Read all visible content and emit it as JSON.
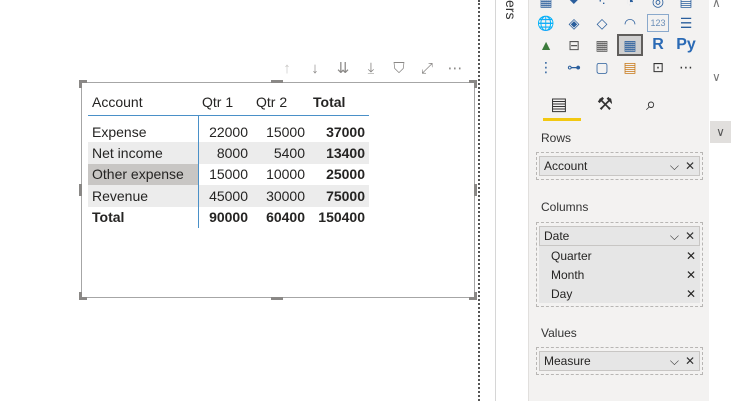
{
  "visual_header": {
    "icons": [
      "arrow-up-icon",
      "arrow-down-icon",
      "double-arrow-down-icon",
      "expand-all-down-icon",
      "filter-icon",
      "focus-mode-icon",
      "more-options-icon"
    ],
    "glyphs": [
      "↑",
      "↓",
      "⇊",
      "⤓",
      "⛉",
      "⤢",
      "⋯"
    ]
  },
  "matrix": {
    "headers": [
      "Account",
      "Qtr 1",
      "Qtr 2",
      "Total"
    ],
    "rows": [
      {
        "account": "Expense",
        "q1": "22000",
        "q2": "15000",
        "total": "37000"
      },
      {
        "account": "Net income",
        "q1": "8000",
        "q2": "5400",
        "total": "13400"
      },
      {
        "account": "Other expense",
        "q1": "15000",
        "q2": "10000",
        "total": "25000"
      },
      {
        "account": "Revenue",
        "q1": "45000",
        "q2": "30000",
        "total": "75000"
      }
    ],
    "total_row": {
      "account": "Total",
      "q1": "90000",
      "q2": "60400",
      "total": "150400"
    }
  },
  "filters_pane": {
    "label": "ers"
  },
  "viz_pane": {
    "icons": [
      {
        "name": "table-icon",
        "glyph": "▦"
      },
      {
        "name": "funnel-icon",
        "glyph": "⏷"
      },
      {
        "name": "scatter-icon",
        "glyph": "⁖"
      },
      {
        "name": "pie-icon",
        "glyph": "◔"
      },
      {
        "name": "donut-icon",
        "glyph": "◎"
      },
      {
        "name": "treemap-icon",
        "glyph": "▤"
      },
      {
        "name": "globe-map-icon",
        "glyph": "🌐"
      },
      {
        "name": "filled-map-icon",
        "glyph": "◈"
      },
      {
        "name": "shape-map-icon",
        "glyph": "◇"
      },
      {
        "name": "gauge-icon",
        "glyph": "◠"
      },
      {
        "name": "card-icon",
        "glyph": "123"
      },
      {
        "name": "multirow-card-icon",
        "glyph": "☰"
      },
      {
        "name": "kpi-icon",
        "glyph": "▲"
      },
      {
        "name": "slicer-icon",
        "glyph": "⊟"
      },
      {
        "name": "table-grid-icon",
        "glyph": "▦"
      },
      {
        "name": "matrix-icon",
        "glyph": "▦"
      },
      {
        "name": "r-visual-icon",
        "glyph": "R"
      },
      {
        "name": "python-visual-icon",
        "glyph": "Py"
      },
      {
        "name": "key-influencers-icon",
        "glyph": "⋮"
      },
      {
        "name": "decomposition-tree-icon",
        "glyph": "⊶"
      },
      {
        "name": "qa-icon",
        "glyph": "▢"
      },
      {
        "name": "smart-narrative-icon",
        "glyph": "▤"
      },
      {
        "name": "paginated-report-icon",
        "glyph": "⊡"
      },
      {
        "name": "more-visuals-icon",
        "glyph": "⋯"
      }
    ],
    "tabs": [
      {
        "name": "fields-tab-icon",
        "glyph": "▤"
      },
      {
        "name": "format-tab-icon",
        "glyph": "⚒"
      },
      {
        "name": "analytics-tab-icon",
        "glyph": "⌕"
      }
    ],
    "rows_label": "Rows",
    "rows_field": "Account",
    "columns_label": "Columns",
    "columns_field": "Date",
    "columns_subfields": [
      "Quarter",
      "Month",
      "Day"
    ],
    "values_label": "Values",
    "values_field": "Measure",
    "remove_glyph": "✕",
    "chevron_glyph": "⌵"
  },
  "rail": {
    "up_glyph": "∧",
    "down_glyph": "∨",
    "collapse_glyph": "∨"
  }
}
